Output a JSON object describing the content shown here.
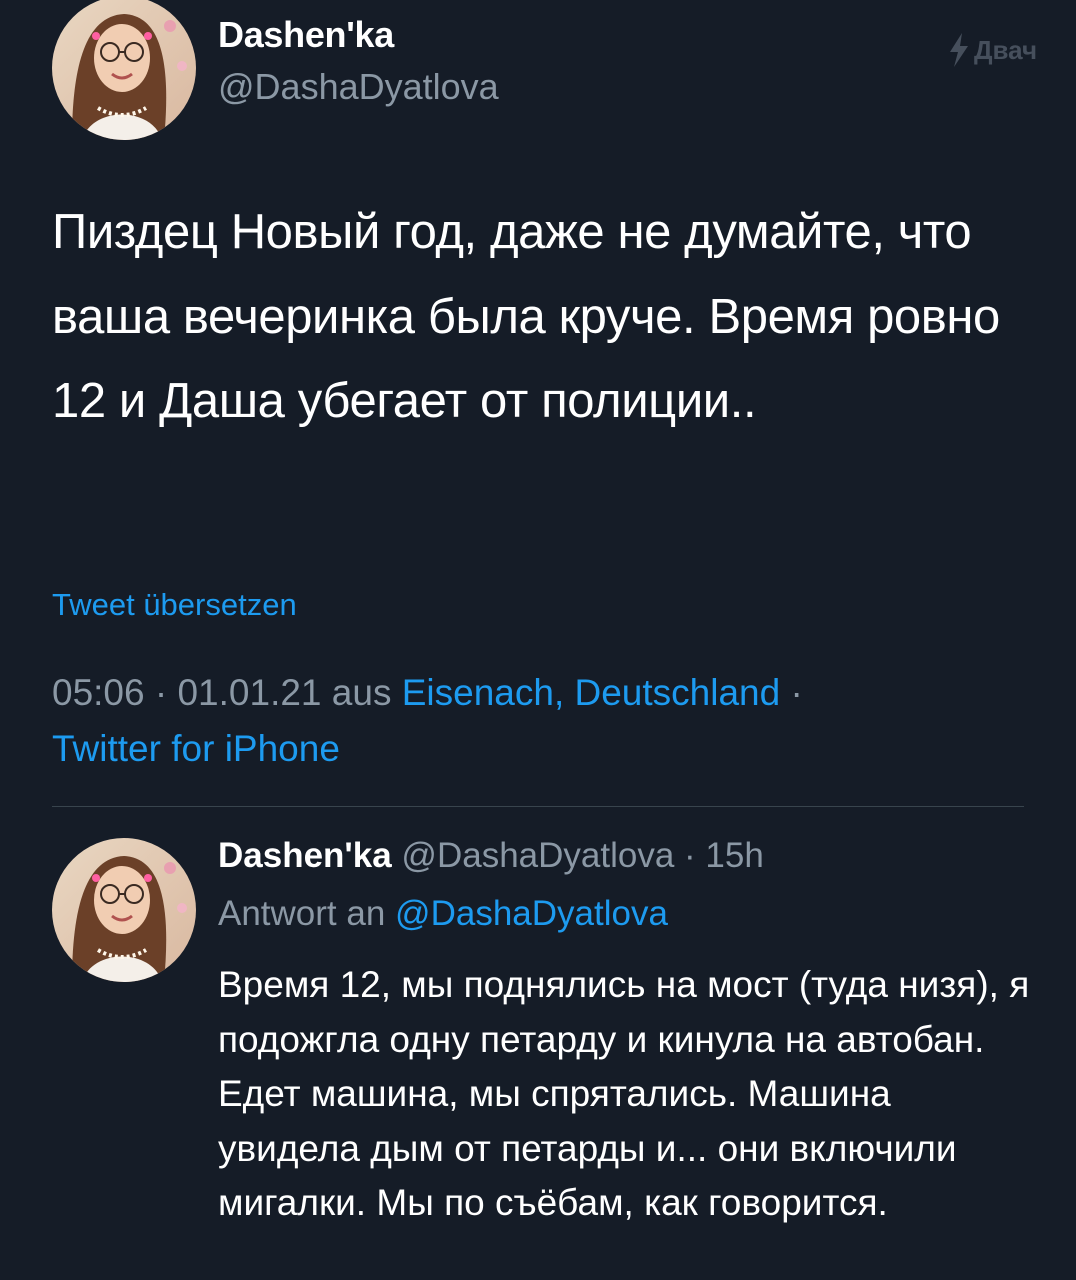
{
  "watermark": {
    "text": "Двач",
    "icon": "lightning-bolt-icon"
  },
  "main_tweet": {
    "avatar_icon": "profile-photo-avatar",
    "display_name": "Dashen'ka",
    "handle": "@DashaDyatlova",
    "text": "Пиздец Новый год, даже не думайте, что ваша вечеринка была круче. Время ровно 12 и Даша убегает от полиции..",
    "translate_label": "Tweet übersetzen",
    "time": "05:06",
    "separator": " · ",
    "date": "01.01.21",
    "location_prefix": " aus ",
    "location": "Eisenach, Deutschland",
    "separator_end": " ·",
    "source": "Twitter for iPhone"
  },
  "reply": {
    "avatar_icon": "profile-photo-avatar",
    "display_name": "Dashen'ka",
    "handle": "@DashaDyatlova",
    "separator": " · ",
    "age": "15h",
    "reply_to_prefix": "Antwort an ",
    "reply_to_handle": "@DashaDyatlova",
    "text": "Время 12, мы поднялись на мост (туда низя), я подожгла одну петарду и кинула на автобан. Едет машина, мы спрятались. Машина увидела дым от петарды и... они включили мигалки. Мы по съёбам, как говорится."
  },
  "colors": {
    "background": "#151c27",
    "text_primary": "#ffffff",
    "text_secondary": "#8b98a5",
    "accent": "#1d9bf0",
    "divider": "#38444d"
  }
}
